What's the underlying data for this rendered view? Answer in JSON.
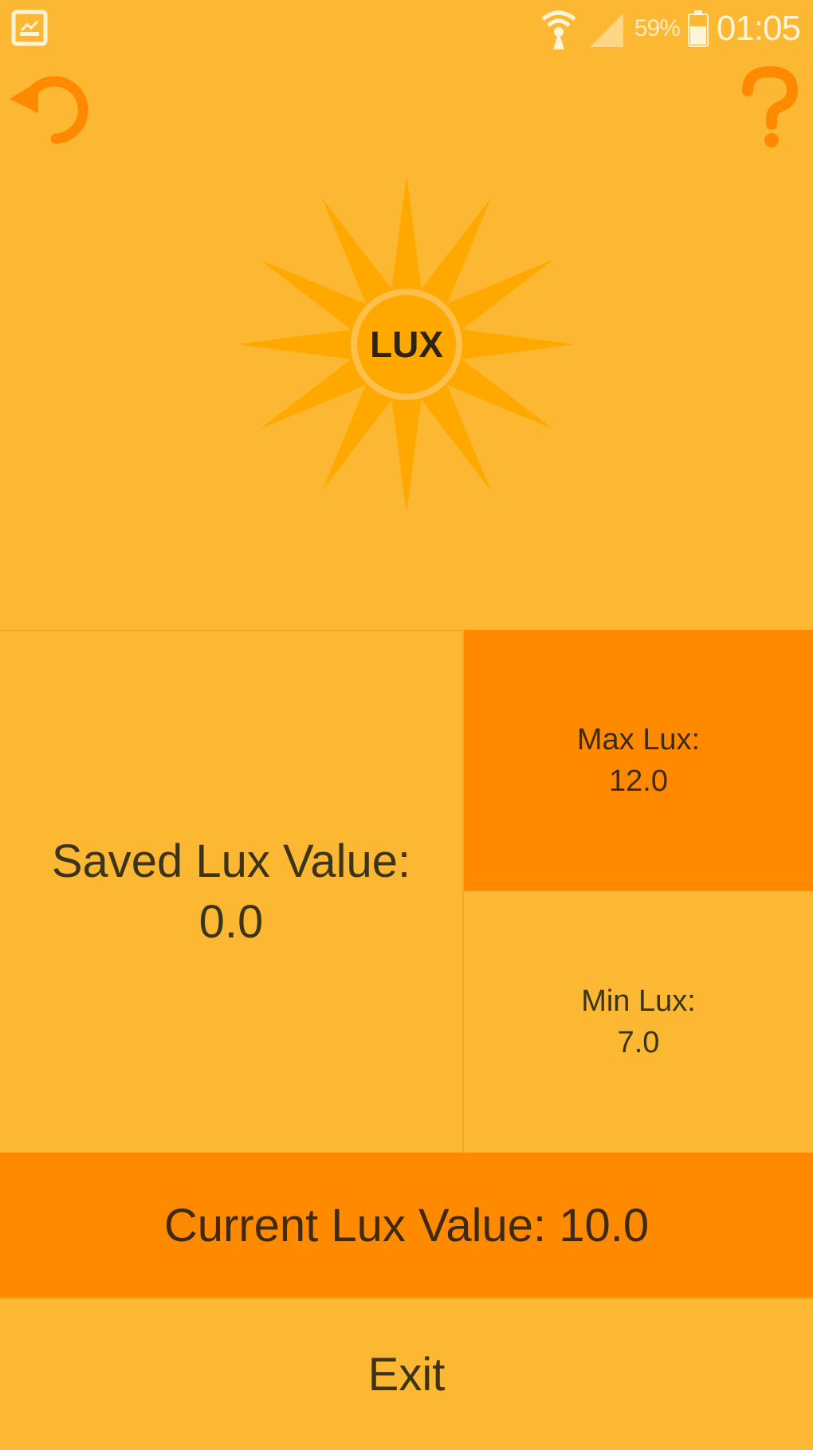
{
  "status_bar": {
    "battery_percent": "59%",
    "time": "01:05",
    "icons": [
      "gallery-icon",
      "wifi-icon",
      "signal-icon",
      "battery-icon"
    ]
  },
  "toolbar": {
    "refresh_icon": "refresh-icon",
    "help_icon": "help-icon"
  },
  "logo": {
    "text": "LUX",
    "icon": "sun-icon"
  },
  "saved": {
    "label": "Saved Lux Value:",
    "value": "0.0"
  },
  "max": {
    "label": "Max Lux:",
    "value": "12.0"
  },
  "min": {
    "label": "Min Lux:",
    "value": "7.0"
  },
  "current": {
    "label": "Current Lux Value: 10.0"
  },
  "exit": {
    "label": "Exit"
  },
  "colors": {
    "background": "#FDB833",
    "accent": "#FF8A00",
    "sun": "#FFA800"
  }
}
